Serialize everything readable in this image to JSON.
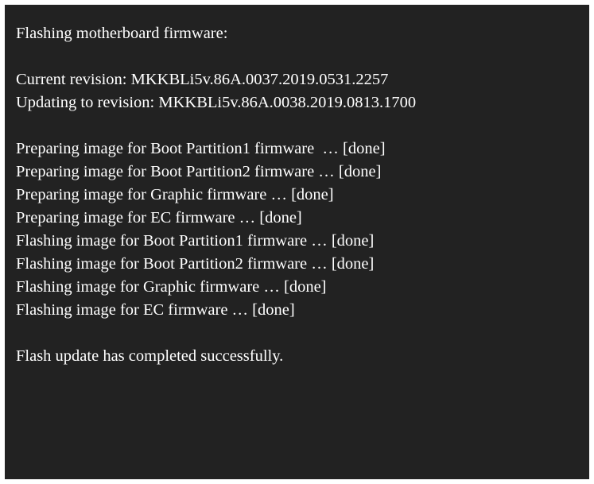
{
  "colors": {
    "background": "#222222",
    "text": "#ffffff",
    "frame": "#ffffff"
  },
  "console": {
    "title": "Flashing motherboard firmware:",
    "current_revision": "Current revision: MKKBLi5v.86A.0037.2019.0531.2257",
    "updating_revision": "Updating to revision: MKKBLi5v.86A.0038.2019.0813.1700",
    "steps": [
      "Preparing image for Boot Partition1 firmware  … [done]",
      "Preparing image for Boot Partition2 firmware … [done]",
      "Preparing image for Graphic firmware … [done]",
      "Preparing image for EC firmware … [done]",
      "Flashing image for Boot Partition1 firmware … [done]",
      "Flashing image for Boot Partition2 firmware … [done]",
      "Flashing image for Graphic firmware … [done]",
      "Flashing image for EC firmware … [done]"
    ],
    "completion": "Flash update has completed successfully."
  }
}
